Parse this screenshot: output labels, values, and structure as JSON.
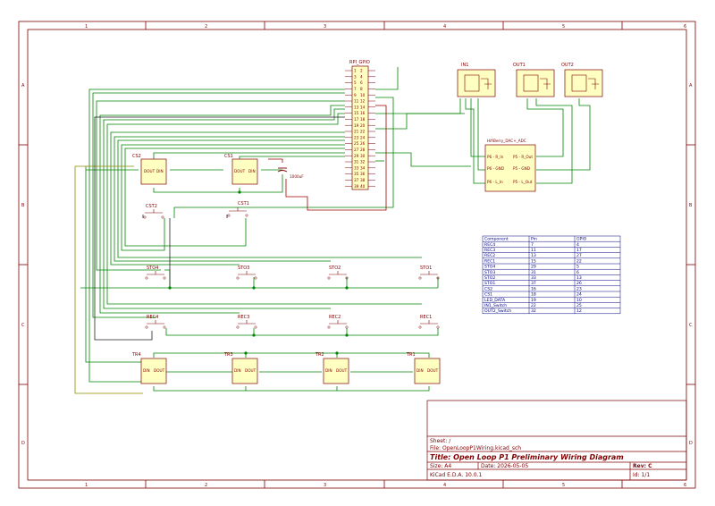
{
  "frame": {
    "columns": [
      "1",
      "2",
      "3",
      "4",
      "5",
      "6"
    ],
    "rows": [
      "A",
      "B",
      "C",
      "D"
    ]
  },
  "header": {
    "rpi_label": "RPI_GPIO",
    "rpi_pins_left": [
      "1",
      "3",
      "5",
      "7",
      "9",
      "11",
      "13",
      "15",
      "17",
      "19",
      "21",
      "23",
      "25",
      "27",
      "29",
      "31",
      "33",
      "35",
      "37",
      "39"
    ],
    "rpi_pins_right": [
      "2",
      "4",
      "6",
      "8",
      "10",
      "12",
      "14",
      "16",
      "18",
      "20",
      "22",
      "24",
      "26",
      "28",
      "30",
      "32",
      "34",
      "36",
      "38",
      "40"
    ]
  },
  "jacks": {
    "in1": "IN1",
    "out1": "OUT1",
    "out2": "OUT2"
  },
  "dac": {
    "title": "HifiBerry_DAC+_ADC",
    "left_pins": [
      "P6 - R_In",
      "P6 - GND",
      "P6 - L_In"
    ],
    "right_pins": [
      "P5 - R_Out",
      "P5 - GND",
      "P5 - L_Out"
    ]
  },
  "components": {
    "cs2": "CS2",
    "cs1": "CS1",
    "cap_value": "1000uF",
    "cst2": "CST2",
    "cst1": "CST1",
    "sto": [
      "STO4",
      "STO3",
      "STO2",
      "STO1"
    ],
    "rec": [
      "REC4",
      "REC3",
      "REC2",
      "REC1"
    ],
    "tr": [
      "TR4",
      "TR3",
      "TR2",
      "TR1"
    ],
    "ic_pin_din": "DIN",
    "ic_pin_dout": "DOUT"
  },
  "pin_table": {
    "headers": [
      "Component",
      "Pin",
      "GPIO"
    ],
    "rows": [
      [
        "REC4",
        "7",
        "4"
      ],
      [
        "REC3",
        "11",
        "17"
      ],
      [
        "REC2",
        "13",
        "27"
      ],
      [
        "REC1",
        "15",
        "22"
      ],
      [
        "STO4",
        "29",
        "5"
      ],
      [
        "STO3",
        "31",
        "6"
      ],
      [
        "STO2",
        "33",
        "13"
      ],
      [
        "STO1",
        "37",
        "26"
      ],
      [
        "CS2",
        "16",
        "23"
      ],
      [
        "CS1",
        "18",
        "24"
      ],
      [
        "LED_DATA",
        "19",
        "10"
      ],
      [
        "IN1_Switch",
        "22",
        "25"
      ],
      [
        "OUT2_Switch",
        "32",
        "12"
      ]
    ]
  },
  "title_block": {
    "sheet": "Sheet: /",
    "file": "File: OpenLoopP1Wiring.kicad_sch",
    "title": "Title: Open Loop P1 Preliminary Wiring Diagram",
    "size": "Size: A4",
    "date": "Date: 2026-05-05",
    "rev": "Rev: C",
    "tool": "KiCad E.D.A. 10.0.1",
    "id": "Id: 1/1"
  },
  "colors": {
    "border": "#800000",
    "wire": "#008400",
    "wire_alt": "#8c8c00",
    "bus": "#000000",
    "red": "#a00000",
    "component_fill": "#ffffc2",
    "table_line": "#000080"
  }
}
